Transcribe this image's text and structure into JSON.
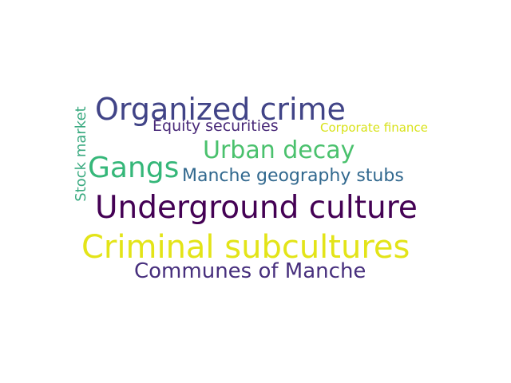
{
  "word_cloud": {
    "words": [
      {
        "text": "Organized crime",
        "color": "#414487"
      },
      {
        "text": "Equity securities",
        "color": "#482878"
      },
      {
        "text": "Corporate finance",
        "color": "#d8e219"
      },
      {
        "text": "Urban decay",
        "color": "#4ac16d"
      },
      {
        "text": "Gangs",
        "color": "#35b779"
      },
      {
        "text": "Manche geography stubs",
        "color": "#31688e"
      },
      {
        "text": "Underground culture",
        "color": "#440154"
      },
      {
        "text": "Criminal subcultures",
        "color": "#e3e418"
      },
      {
        "text": "Communes of Manche",
        "color": "#472f7d"
      },
      {
        "text": "Stock market",
        "color": "#3aaa80"
      }
    ]
  }
}
